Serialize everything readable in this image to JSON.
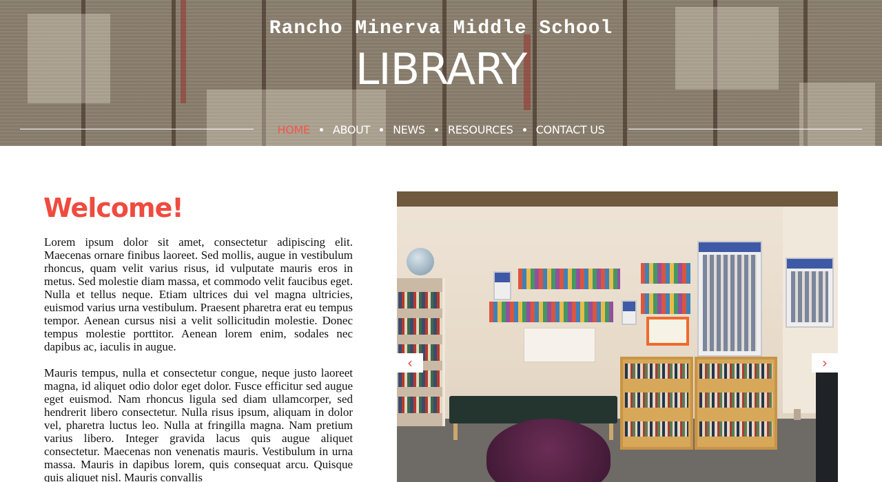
{
  "header": {
    "subtitle": "Rancho Minerva Middle School",
    "title": "LIBRARY"
  },
  "nav": {
    "items": [
      {
        "label": "HOME",
        "active": true
      },
      {
        "label": "ABOUT",
        "active": false
      },
      {
        "label": "NEWS",
        "active": false
      },
      {
        "label": "RESOURCES",
        "active": false
      },
      {
        "label": "CONTACT US",
        "active": false
      }
    ]
  },
  "main": {
    "heading": "Welcome!",
    "paragraphs": [
      "Lorem ipsum dolor sit amet, consectetur adipiscing elit. Maecenas ornare finibus laoreet. Sed mollis, augue in vestibulum rhoncus, quam velit varius risus, id vulputate mauris eros in metus. Sed molestie diam massa, et commodo velit faucibus eget. Nulla et tellus neque. Etiam ultrices dui vel magna ultricies, euismod varius urna vestibulum. Praesent pharetra erat eu tempus tempor. Aenean cursus nisi a velit sollicitudin molestie. Donec tempus molestie porttitor. Aenean lorem enim, sodales nec dapibus ac, iaculis in augue.",
      "Mauris tempus, nulla et consectetur congue, neque justo laoreet magna, id aliquet odio dolor eget dolor. Fusce efficitur sed augue eget euismod. Nam rhoncus ligula sed diam ullamcorper, sed hendrerit libero consectetur. Nulla risus ipsum, aliquam in dolor vel, pharetra luctus leo. Nulla at fringilla magna. Nam pretium varius libero. Integer gravida lacus quis augue aliquet consectetur. Maecenas non venenatis mauris. Vestibulum in urna massa. Mauris in dapibus lorem, quis consequat arcu. Quisque quis aliquet nisl. Mauris convallis"
    ]
  },
  "slideshow": {
    "prev_label": "‹",
    "next_label": "›"
  },
  "colors": {
    "accent": "#ef4b3f",
    "nav_text": "#ffffff",
    "body_text": "#111111"
  }
}
